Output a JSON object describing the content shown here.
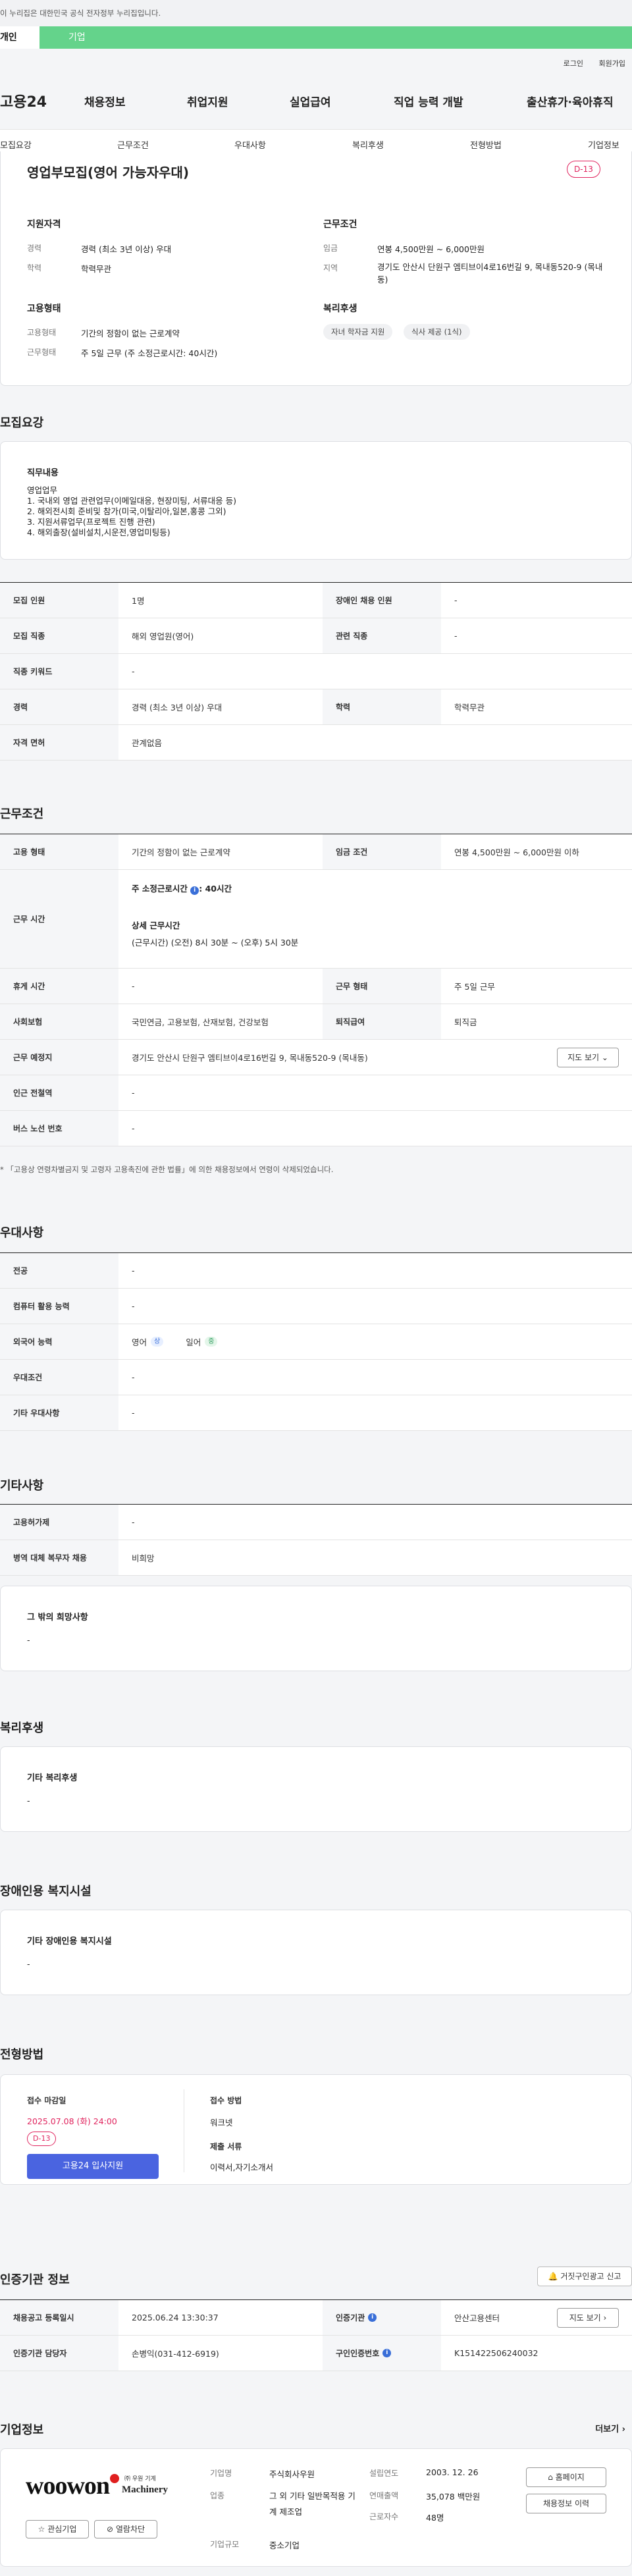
{
  "notice": "이 누리집은 대한민국 공식 전자정부 누리집입니다.",
  "user_tabs": [
    "개인",
    "기업"
  ],
  "top_links": [
    "로그인",
    "회원가입"
  ],
  "gnb": {
    "logo": "고용24",
    "items": [
      "채용정보",
      "취업지원",
      "실업급여",
      "직업 능력 개발",
      "출산휴가·육아휴직"
    ]
  },
  "lnb": [
    "모집요강",
    "근무조건",
    "우대사항",
    "복리후생",
    "전형방법",
    "기업정보"
  ],
  "summary": {
    "title": "영업부모집(영어 가능자우대)",
    "dday": "D-13",
    "qual_title": "지원자격",
    "qual": [
      {
        "label": "경력",
        "value": "경력 (최소 3년 이상) 우대"
      },
      {
        "label": "학력",
        "value": "학력무관"
      }
    ],
    "cond_title": "근무조건",
    "cond": [
      {
        "label": "임금",
        "value": "연봉 4,500만원 ~ 6,000만원"
      },
      {
        "label": "지역",
        "value": "경기도 안산시 단원구 엠티브이4로16번길 9, 목내동520-9 (목내동)"
      }
    ],
    "emp_title": "고용형태",
    "emp": [
      {
        "label": "고용형태",
        "value": "기간의 정함이 없는 근로계약"
      },
      {
        "label": "근무형태",
        "value": "주 5일 근무 (주 소정근로시간: 40시간)"
      }
    ],
    "welfare_title": "복리후생",
    "welfare_tags": [
      "자녀 학자금 지원",
      "식사 제공 (1식)"
    ]
  },
  "recruit": {
    "section": "모집요강",
    "duty_title": "직무내용",
    "duty": [
      "영업업무",
      "1. 국내외 영업 관련업무(이메일대응, 현장미팅, 서류대응 등)",
      "2. 해외전시회 준비및 참가(미국,이탈리아,일본,홍콩 그외)",
      "3. 지원서류업무(프로젝트 진행 관련)",
      "4. 해외출장(설비설치,시운전,영업미팅등)"
    ],
    "rows": [
      {
        "th": "모집 인원",
        "td": "1명",
        "th2": "장애인 채용 인원",
        "td2": "-"
      },
      {
        "th": "모집 직종",
        "td": "해외 영업원(영어)",
        "th2": "관련 직종",
        "td2": "-"
      },
      {
        "th": "직종 키워드",
        "td": "-"
      },
      {
        "th": "경력",
        "td": "경력 (최소 3년 이상) 우대",
        "th2": "학력",
        "td2": "학력무관"
      },
      {
        "th": "자격 면허",
        "td": "관계없음"
      }
    ]
  },
  "work": {
    "section": "근무조건",
    "emp_th": "고용 형태",
    "emp_td": "기간의 정함이 없는 근로계약",
    "wage_th": "임금 조건",
    "wage_td": "연봉 4,500만원 ~ 6,000만원 이하",
    "hours_th": "근무 시간",
    "hours_main": "주 소정근로시간",
    "hours_value": ": 40시간",
    "hours_detail_title": "상세 근무시간",
    "hours_detail": "(근무시간) (오전) 8시 30분 ~ (오후) 5시 30분",
    "rest_th": "휴게 시간",
    "rest_td": "-",
    "type_th": "근무 형태",
    "type_td": "주 5일 근무",
    "ins_th": "사회보험",
    "ins_td": "국민연금, 고용보험, 산재보험, 건강보험",
    "ret_th": "퇴직급여",
    "ret_td": "퇴직금",
    "loc_th": "근무 예정지",
    "loc_td": "경기도 안산시 단원구 엠티브이4로16번길 9, 목내동520-9 (목내동)",
    "map_btn": "지도 보기",
    "sub_th": "인근 전철역",
    "sub_td": "-",
    "bus_th": "버스 노선 번호",
    "bus_td": "-",
    "footnote": "* 「고용상 연령차별금지 및 고령자 고용촉진에 관한 법률」에 의한 채용정보에서 연령이 삭제되었습니다."
  },
  "pref": {
    "section": "우대사항",
    "rows": [
      {
        "th": "전공",
        "td": "-"
      },
      {
        "th": "컴퓨터 활용 능력",
        "td": "-"
      },
      {
        "th": "외국어 능력",
        "td": ""
      },
      {
        "th": "우대조건",
        "td": "-"
      },
      {
        "th": "기타 우대사항",
        "td": "-"
      }
    ],
    "langs": [
      {
        "name": "영어",
        "level": "상",
        "color": "#3a6fd8",
        "bg": "#e7efff"
      },
      {
        "name": "일어",
        "level": "중",
        "color": "#2a9a5a",
        "bg": "#e4f6ea"
      }
    ]
  },
  "etc": {
    "section": "기타사항",
    "rows": [
      {
        "th": "고용허가제",
        "td": "-"
      },
      {
        "th": "병역 대체 복무자 채용",
        "td": "비희망"
      }
    ],
    "other_title": "그 밖의 희망사항",
    "other_value": "-"
  },
  "welfare": {
    "section": "복리후생",
    "title": "기타 복리후생",
    "value": "-"
  },
  "disability": {
    "section": "장애인용 복지시설",
    "title": "기타 장애인용 복지시설",
    "value": "-"
  },
  "selection": {
    "section": "전형방법",
    "deadline_label": "접수 마감일",
    "deadline": "2025.07.08 (화) 24:00",
    "dday": "D-13",
    "apply_btn": "고용24 입사지원",
    "method_label": "접수 방법",
    "method": "워크넷",
    "doc_label": "제출 서류",
    "docs": "이력서,자기소개서"
  },
  "cert": {
    "section": "인증기관 정보",
    "report_btn": "거짓구인광고 신고",
    "reg_th": "채용공고 등록일시",
    "reg_td": "2025.06.24 13:30:37",
    "org_th": "인증기관",
    "org_td": "안산고용센터",
    "map_btn": "지도 보기",
    "mgr_th": "인증기관 담당자",
    "mgr_td": "손병익(031-412-6919)",
    "num_th": "구인인증번호",
    "num_td": "K151422506240032"
  },
  "company": {
    "section": "기업정보",
    "more": "더보기",
    "logo_main": "woowon",
    "logo_sub": "Machinery",
    "logo_kor": "㈜ 우원 기계",
    "fav_btn": "관심기업",
    "block_btn": "열람차단",
    "name_label": "기업명",
    "name": "주식회사우원",
    "industry_label": "업종",
    "industry": "그 외 기타 일반목적용 기계 제조업",
    "size_label": "기업규모",
    "size": "중소기업",
    "year_label": "설립연도",
    "year": "2003. 12. 26",
    "sales_label": "연매출액",
    "sales": "35,078 백만원",
    "emp_label": "근로자수",
    "emp": "48명",
    "home_btn": "홈페이지",
    "history_btn": "채용정보 이력"
  }
}
